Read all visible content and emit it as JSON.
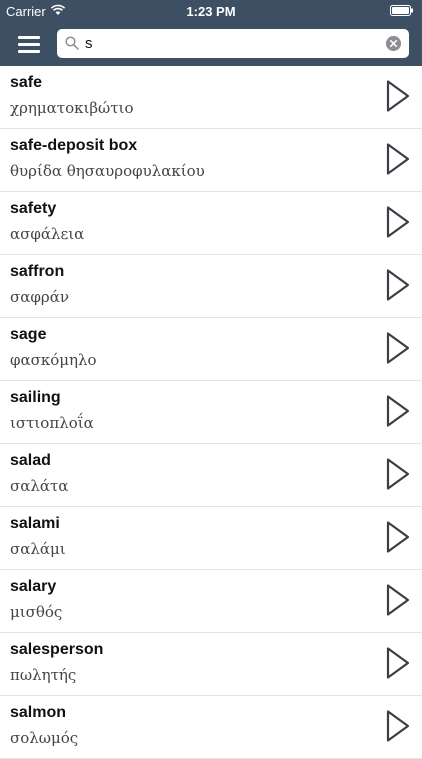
{
  "status_bar": {
    "carrier": "Carrier",
    "time": "1:23 PM"
  },
  "search": {
    "value": "s",
    "placeholder": ""
  },
  "colors": {
    "header_bg": "#3d4f63",
    "divider": "#e3e3e3"
  },
  "entries": [
    {
      "term": "safe",
      "translation": "χρηματοκιβώτιο"
    },
    {
      "term": "safe-deposit box",
      "translation": "θυρίδα θησαυροφυλακίου"
    },
    {
      "term": "safety",
      "translation": "ασφάλεια"
    },
    {
      "term": "saffron",
      "translation": "σαφράν"
    },
    {
      "term": "sage",
      "translation": "φασκόμηλο"
    },
    {
      "term": "sailing",
      "translation": "ιστιοπλοΐα"
    },
    {
      "term": "salad",
      "translation": "σαλάτα"
    },
    {
      "term": "salami",
      "translation": "σαλάμι"
    },
    {
      "term": "salary",
      "translation": "μισθός"
    },
    {
      "term": "salesperson",
      "translation": "πωλητής"
    },
    {
      "term": "salmon",
      "translation": "σολωμός"
    }
  ]
}
